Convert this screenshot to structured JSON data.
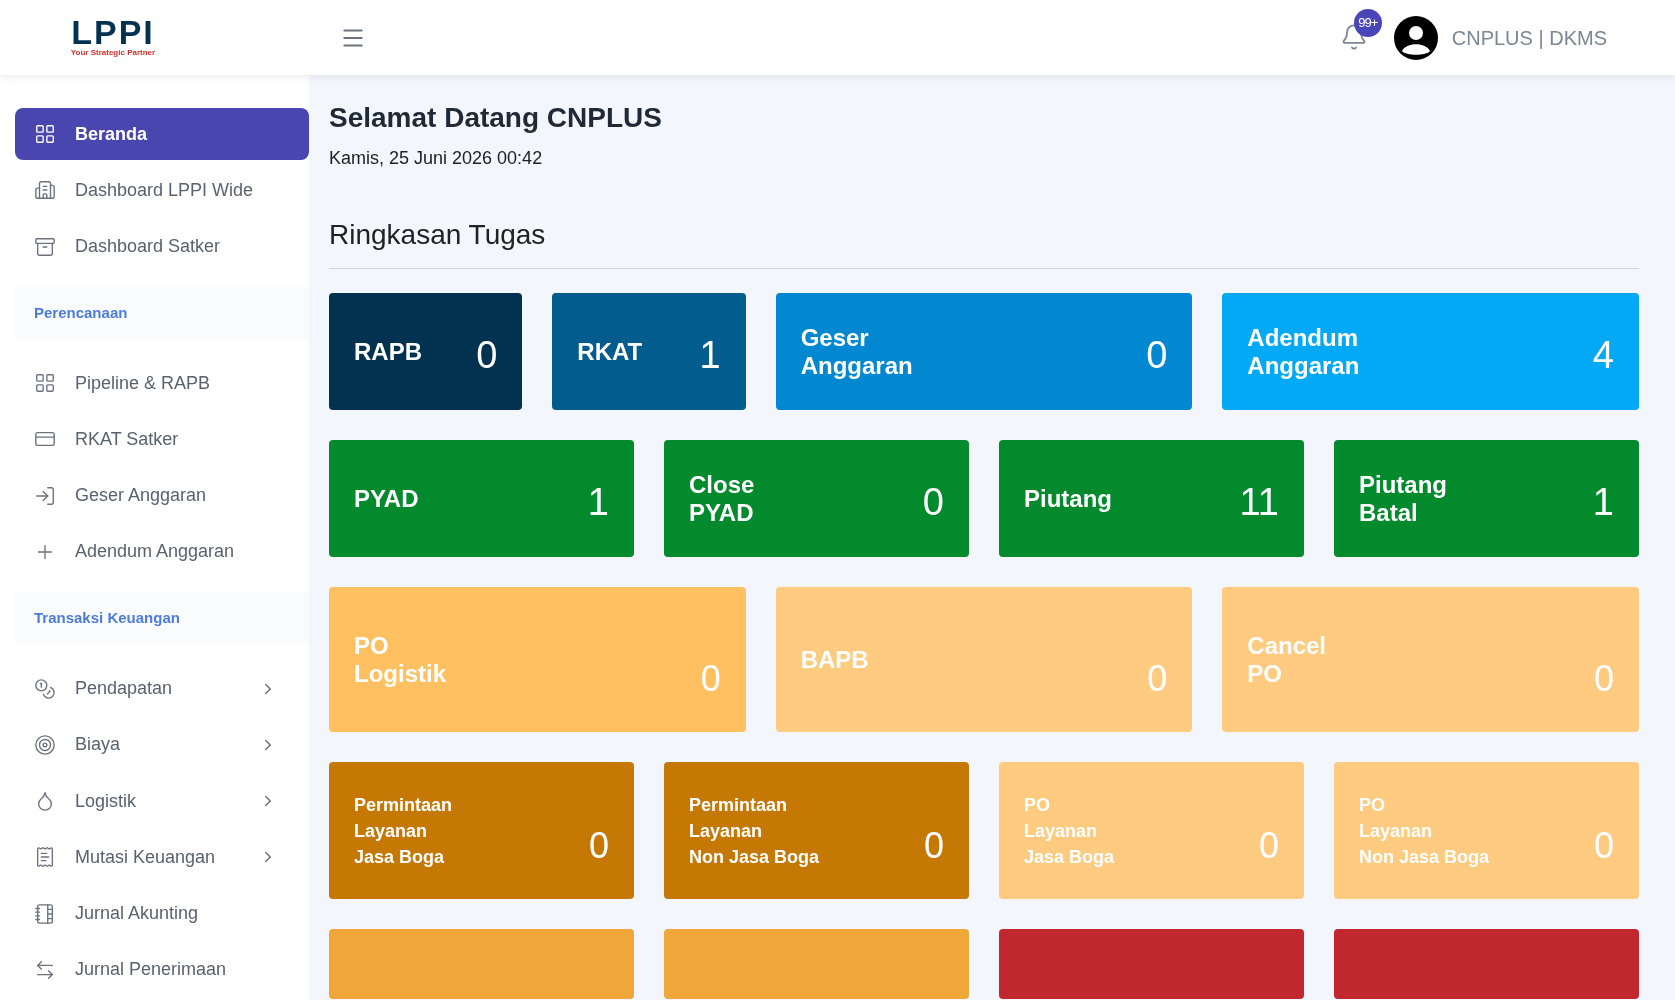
{
  "header": {
    "logo_text": "LPPI",
    "logo_tagline": "Your Strategic Partner",
    "notification_count": "99+",
    "user": "CNPLUS | DKMS"
  },
  "sidebar": [
    {
      "kind": "item",
      "label": "Beranda",
      "selected": true,
      "has_submenu": false
    },
    {
      "kind": "item",
      "label": "Dashboard LPPI Wide",
      "selected": false,
      "has_submenu": false
    },
    {
      "kind": "item",
      "label": "Dashboard Satker",
      "selected": false,
      "has_submenu": false
    },
    {
      "kind": "section",
      "label": "Perencanaan"
    },
    {
      "kind": "item",
      "label": "Pipeline & RAPB",
      "selected": false,
      "has_submenu": false
    },
    {
      "kind": "item",
      "label": "RKAT Satker",
      "selected": false,
      "has_submenu": false
    },
    {
      "kind": "item",
      "label": "Geser Anggaran",
      "selected": false,
      "has_submenu": false
    },
    {
      "kind": "item",
      "label": "Adendum Anggaran",
      "selected": false,
      "has_submenu": false
    },
    {
      "kind": "section",
      "label": "Transaksi Keuangan"
    },
    {
      "kind": "item",
      "label": "Pendapatan",
      "selected": false,
      "has_submenu": true
    },
    {
      "kind": "item",
      "label": "Biaya",
      "selected": false,
      "has_submenu": true
    },
    {
      "kind": "item",
      "label": "Logistik",
      "selected": false,
      "has_submenu": true
    },
    {
      "kind": "item",
      "label": "Mutasi Keuangan",
      "selected": false,
      "has_submenu": true
    },
    {
      "kind": "item",
      "label": "Jurnal Akunting",
      "selected": false,
      "has_submenu": false
    },
    {
      "kind": "item",
      "label": "Jurnal Penerimaan",
      "selected": false,
      "has_submenu": false
    }
  ],
  "greeting": "Selamat Datang CNPLUS",
  "date": "Kamis, 25 Juni 2026 00:42",
  "section_title": "Ringkasan Tugas",
  "cards": [
    {
      "lines": [
        "RAPB"
      ],
      "value": "0",
      "color": "#023250",
      "kind": "large"
    },
    {
      "lines": [
        "RKAT"
      ],
      "value": "1",
      "color": "#025c8e",
      "kind": "large"
    },
    {
      "lines": [
        "Geser",
        "Anggaran"
      ],
      "value": "0",
      "color": "#0288d1",
      "kind": "large"
    },
    {
      "lines": [
        "Adendum",
        "Anggaran"
      ],
      "value": "4",
      "color": "#03a9f4",
      "kind": "large"
    },
    {
      "lines": [
        "PYAD"
      ],
      "value": "1",
      "color": "#028a2d",
      "kind": "large"
    },
    {
      "lines": [
        "Close",
        "PYAD"
      ],
      "value": "0",
      "color": "#028a2d",
      "kind": "large"
    },
    {
      "lines": [
        "Piutang"
      ],
      "value": "11",
      "color": "#028a2d",
      "kind": "large"
    },
    {
      "lines": [
        "Piutang",
        "Batal"
      ],
      "value": "1",
      "color": "#028a2d",
      "kind": "large"
    },
    {
      "lines": [
        "PO",
        "Logistik"
      ],
      "value": "0",
      "color": "#fec061",
      "kind": "tall"
    },
    {
      "lines": [
        "BAPB"
      ],
      "value": "0",
      "color": "#fecb80",
      "kind": "tall"
    },
    {
      "lines": [
        "Cancel",
        "PO"
      ],
      "value": "0",
      "color": "#fecb80",
      "kind": "tall"
    },
    {
      "lines": [
        "Permintaan",
        "Layanan",
        "Jasa Boga"
      ],
      "value": "0",
      "color": "#c67805",
      "kind": "small"
    },
    {
      "lines": [
        "Permintaan",
        "Layanan",
        "Non Jasa Boga"
      ],
      "value": "0",
      "color": "#c67805",
      "kind": "small"
    },
    {
      "lines": [
        "PO",
        "Layanan",
        "Jasa Boga"
      ],
      "value": "0",
      "color": "#fecb80",
      "kind": "small"
    },
    {
      "lines": [
        "PO",
        "Layanan",
        "Non Jasa Boga"
      ],
      "value": "0",
      "color": "#fecb80",
      "kind": "small"
    },
    {
      "color": "#efa73a",
      "kind": "cut"
    },
    {
      "color": "#efa73a",
      "kind": "cut"
    },
    {
      "color": "#c1272f",
      "kind": "cut"
    },
    {
      "color": "#c1272f",
      "kind": "cut"
    }
  ]
}
